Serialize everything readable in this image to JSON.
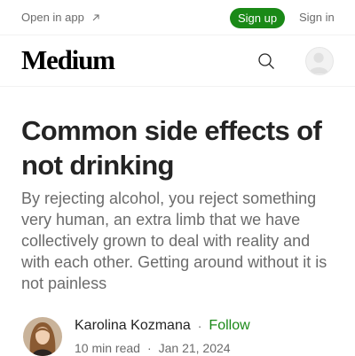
{
  "topbar": {
    "open_in_app": "Open in app",
    "sign_up": "Sign up",
    "sign_in": "Sign in"
  },
  "header": {
    "logo": "Medium",
    "search_icon": "search-icon",
    "avatar_icon": "user-avatar-icon"
  },
  "article": {
    "title": "Common side effects of not drinking",
    "subtitle": "By rejecting alcohol, you reject something very human, an extra limb that we have collectively grown to deal with reality and with each other. Getting around without it is not painless",
    "author": {
      "name": "Karolina Kozmana",
      "follow": "Follow",
      "separator": "·"
    },
    "meta": {
      "read_time": "10 min read",
      "separator": "·",
      "date": "Jan 21, 2024"
    }
  },
  "colors": {
    "accent_green": "#1a8917",
    "text_primary": "#242424",
    "text_secondary": "#6b6b6b"
  }
}
